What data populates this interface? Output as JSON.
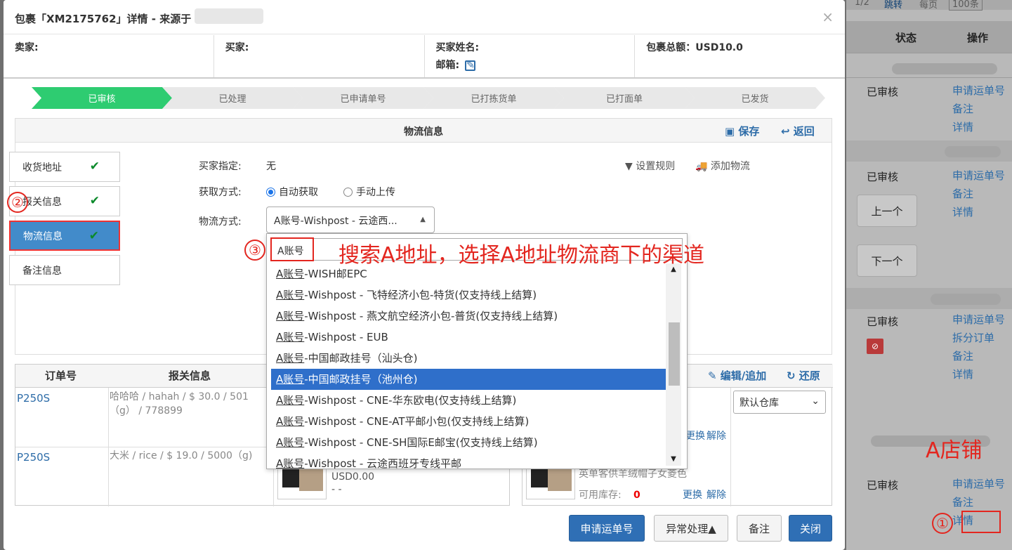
{
  "background": {
    "pager_page": "1/2",
    "pager_jump": "跳转",
    "pager_per_page": "每页",
    "pager_size": "100条",
    "col_status": "状态",
    "col_action": "操作",
    "rows": [
      {
        "status": "已审核",
        "actions": [
          "申请运单号",
          "备注",
          "详情"
        ]
      },
      {
        "status": "已审核",
        "actions": [
          "申请运单号",
          "备注",
          "详情"
        ]
      },
      {
        "status": "已审核",
        "actions": [
          "申请运单号",
          "拆分订单",
          "备注",
          "详情"
        ]
      },
      {
        "status": "已审核",
        "actions": [
          "申请运单号",
          "备注",
          "详情"
        ]
      }
    ],
    "prev_label": "上一个",
    "next_label": "下一个"
  },
  "dialog": {
    "title": "包裹「XM2175762」详情 - 来源于",
    "close": "×",
    "info": {
      "seller": "卖家:",
      "buyer": "买家:",
      "buyer_name": "买家姓名:",
      "email": "邮箱:",
      "total": "包裹总额：USD10.0"
    },
    "steps": [
      "已审核",
      "已处理",
      "已申请单号",
      "已打拣货单",
      "已打面单",
      "已发货"
    ],
    "logistics": {
      "title": "物流信息",
      "save": "保存",
      "back": "返回",
      "tabs": [
        "收货地址",
        "报关信息",
        "物流信息",
        "备注信息"
      ],
      "buyer_assign_label": "买家指定:",
      "buyer_assign_value": "无",
      "fetch_label": "获取方式:",
      "fetch_auto": "自动获取",
      "fetch_manual": "手动上传",
      "method_label": "物流方式:",
      "method_value": "A账号-Wishpost - 云途西...",
      "set_rules": "设置规则",
      "add_logistics": "添加物流"
    },
    "dropdown": {
      "search_value": "A账号",
      "options": [
        "A账号-WISH邮EPC",
        "A账号-Wishpost - 飞特经济小包-特货(仅支持线上结算)",
        "A账号-Wishpost - 燕文航空经济小包-普货(仅支持线上结算)",
        "A账号-Wishpost - EUB",
        "A账号-中国邮政挂号（汕头仓)",
        "A账号-中国邮政挂号（池州仓)",
        "A账号-Wishpost - CNE-华东欧电(仅支持线上结算)",
        "A账号-Wishpost - CNE-AT平邮小包(仅支持线上结算)",
        "A账号-Wishpost - CNE-SH国际E邮宝(仅支持线上结算)",
        "A账号-Wishpost - 云途西班牙专线平邮"
      ],
      "highlighted_index": 5
    },
    "orders": {
      "col_order": "订单号",
      "col_customs": "报关信息",
      "edit_add": "编辑/追加",
      "restore": "还原",
      "warehouse": "默认仓库",
      "rows": [
        {
          "order": "P250S",
          "customs": "哈哈哈 / hahah / $ 30.0 / 501 （g） / 778899"
        },
        {
          "order": "P250S",
          "customs": "大米 / rice / $ 19.0 / 5000（g)",
          "price": "USD0.00",
          "price2": "- -",
          "product": "英单客供羊绒帽子女菱色",
          "stock_label": "可用库存:",
          "stock_value": "0"
        }
      ],
      "replace": "更换",
      "unbind": "解除"
    },
    "buttons": {
      "apply": "申请运单号",
      "exception": "异常处理▲",
      "remark": "备注",
      "close": "关闭"
    }
  },
  "annotations": {
    "c1": "①",
    "c2": "②",
    "c3": "③",
    "instruction": "搜索A地址，选择A地址物流商下的渠道",
    "shop": "A店铺"
  }
}
